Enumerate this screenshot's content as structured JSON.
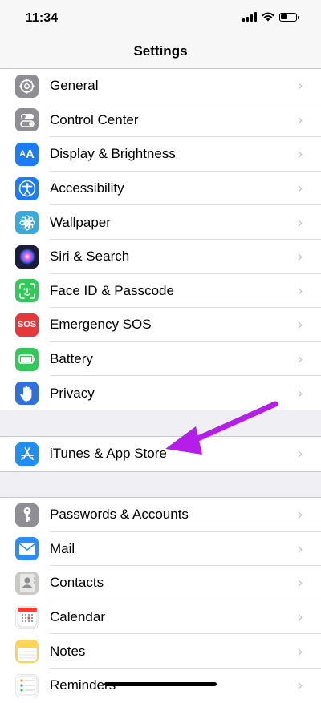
{
  "status_bar": {
    "time": "11:34"
  },
  "nav": {
    "title": "Settings"
  },
  "groups": [
    [
      {
        "label": "General",
        "icon": "gear-icon",
        "color": "#8e8e93"
      },
      {
        "label": "Control Center",
        "icon": "toggles-icon",
        "color": "#8e8e93"
      },
      {
        "label": "Display & Brightness",
        "icon": "text-size-icon",
        "color": "#1a7cf6"
      },
      {
        "label": "Accessibility",
        "icon": "accessibility-icon",
        "color": "#1a7cf6"
      },
      {
        "label": "Wallpaper",
        "icon": "flower-icon",
        "color": "#36aadc"
      },
      {
        "label": "Siri & Search",
        "icon": "siri-icon",
        "color": "#1c1c3a"
      },
      {
        "label": "Face ID & Passcode",
        "icon": "face-id-icon",
        "color": "#34c759"
      },
      {
        "label": "Emergency SOS",
        "icon": "sos-icon",
        "color": "#e5383b"
      },
      {
        "label": "Battery",
        "icon": "battery-icon",
        "color": "#34c759"
      },
      {
        "label": "Privacy",
        "icon": "hand-icon",
        "color": "#2f6fde"
      }
    ],
    [
      {
        "label": "iTunes & App Store",
        "icon": "app-store-icon",
        "color": "#1e8ef0"
      }
    ],
    [
      {
        "label": "Passwords & Accounts",
        "icon": "key-icon",
        "color": "#8e8e93"
      },
      {
        "label": "Mail",
        "icon": "mail-icon",
        "color": "#2f8cf5"
      },
      {
        "label": "Contacts",
        "icon": "contacts-icon",
        "color": "#c9c8c5"
      },
      {
        "label": "Calendar",
        "icon": "calendar-icon",
        "color": "#ffffff"
      },
      {
        "label": "Notes",
        "icon": "notes-icon",
        "color": "#fdd54a"
      },
      {
        "label": "Reminders",
        "icon": "reminders-icon",
        "color": "#ffffff"
      }
    ]
  ],
  "annotation": {
    "color": "#b41ee8",
    "target": "iTunes & App Store"
  }
}
